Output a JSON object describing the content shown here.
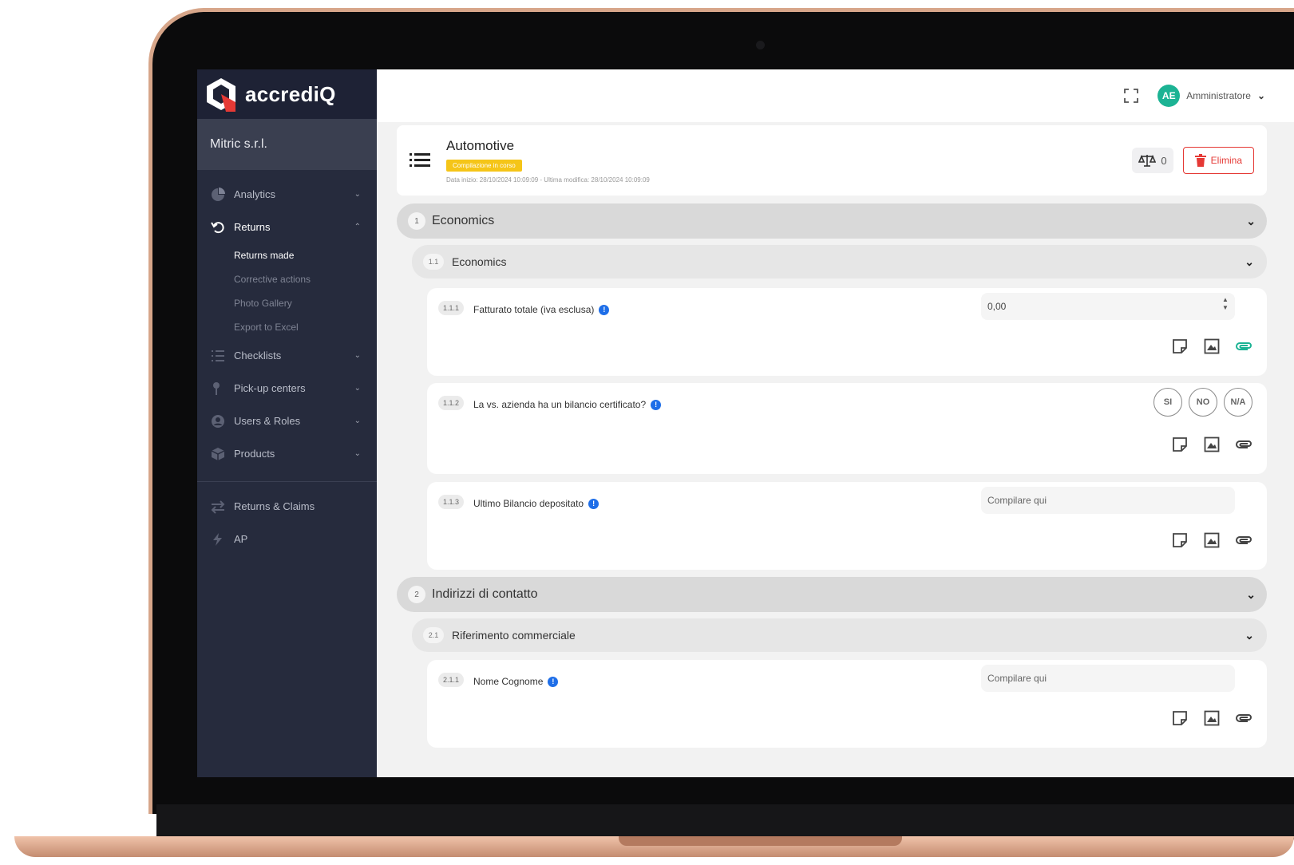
{
  "brand": {
    "name": "accrediQ",
    "logo_icon": "accrediq-logo-icon"
  },
  "organization": "Mitric s.r.l.",
  "sidebar": {
    "items": [
      {
        "label": "Analytics",
        "icon": "pie-chart-icon"
      },
      {
        "label": "Returns",
        "icon": "undo-icon"
      },
      {
        "label": "Checklists",
        "icon": "checklist-icon"
      },
      {
        "label": "Pick-up centers",
        "icon": "pin-icon"
      },
      {
        "label": "Users & Roles",
        "icon": "user-circle-icon"
      },
      {
        "label": "Products",
        "icon": "box-icon"
      }
    ],
    "returns_sub": [
      "Returns made",
      "Corrective actions",
      "Photo Gallery",
      "Export to Excel"
    ],
    "bottom_items": [
      {
        "label": "Returns & Claims",
        "icon": "swap-icon"
      },
      {
        "label": "AP",
        "icon": "bolt-icon"
      }
    ]
  },
  "topbar": {
    "user_initials": "AE",
    "user_name": "Amministratore"
  },
  "header": {
    "title": "Automotive",
    "status": "Compilazione in corso",
    "dates": "Data inizio: 28/10/2024 10:09:09 - Ultima modifica: 28/10/2024 10:09:09",
    "scale_count": "0",
    "delete_label": "Elimina"
  },
  "sections": [
    {
      "num": "1",
      "label": "Economics",
      "sub": {
        "num": "1.1",
        "label": "Economics"
      },
      "questions": [
        {
          "num": "1.1.1",
          "text": "Fatturato totale (iva esclusa)",
          "value": "0,00"
        },
        {
          "num": "1.1.2",
          "text": "La vs. azienda ha un bilancio certificato?",
          "options": [
            "SI",
            "NO",
            "N/A"
          ]
        },
        {
          "num": "1.1.3",
          "text": "Ultimo Bilancio depositato",
          "placeholder": "Compilare qui"
        }
      ]
    },
    {
      "num": "2",
      "label": "Indirizzi di contatto",
      "sub": {
        "num": "2.1",
        "label": "Riferimento commerciale"
      },
      "questions": [
        {
          "num": "2.1.1",
          "text": "Nome Cognome",
          "placeholder": "Compilare qui"
        }
      ]
    }
  ],
  "info_symbol": "!",
  "colors": {
    "sidebar": "#262b3d",
    "accent_green": "#1cb394",
    "badge_yellow": "#f5c518",
    "danger": "#e53935",
    "info_blue": "#1e6ee8"
  }
}
